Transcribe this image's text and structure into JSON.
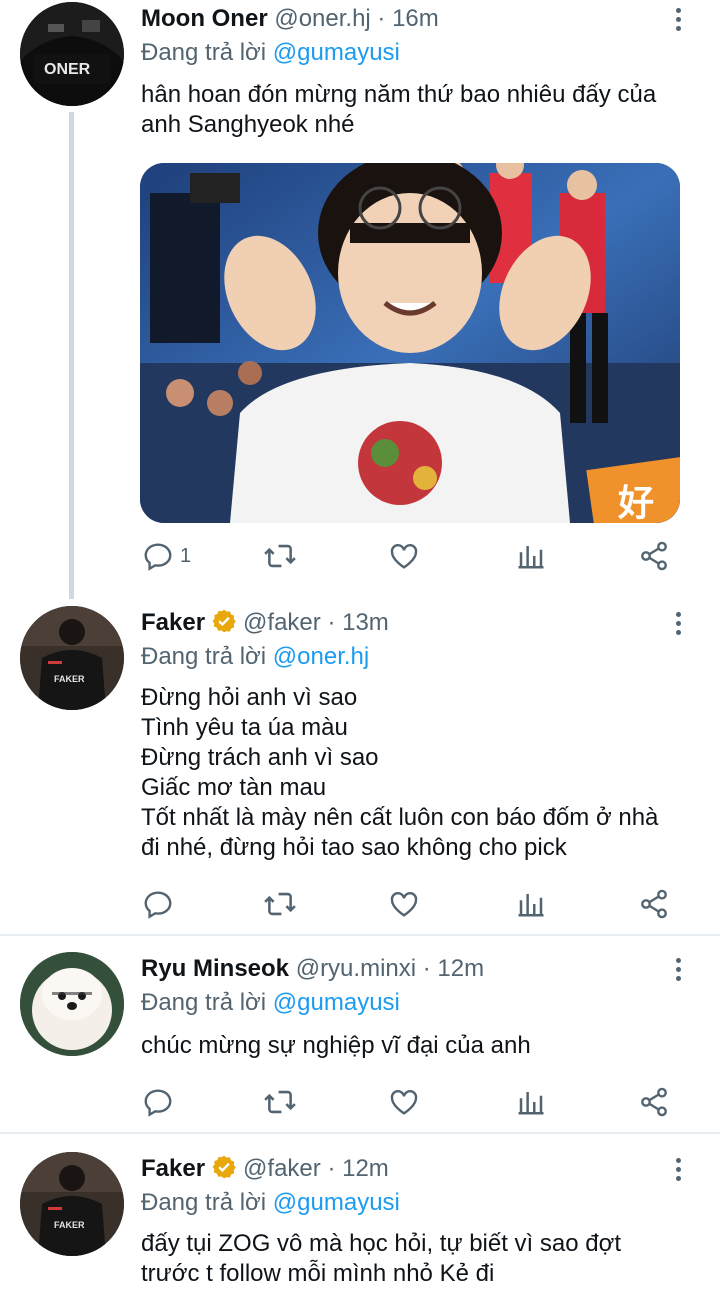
{
  "tweets": [
    {
      "name": "Moon Oner",
      "handle": "@oner.hj",
      "time": "· 16m",
      "reply_prefix": "Đang trả lời",
      "reply_to": "@gumayusi",
      "text": "hân hoan đón mừng năm thứ bao nhiêu đấy của\nanh Sanghyeok nhé",
      "avatar_label": "ONER",
      "reply_count": "1",
      "verified": false
    },
    {
      "name": "Faker",
      "handle": "@faker",
      "time": "· 13m",
      "reply_prefix": "Đang trả lời",
      "reply_to": "@oner.hj",
      "text": "Đừng hỏi anh vì sao\nTình yêu ta úa màu\nĐừng trách anh vì sao\nGiấc mơ tàn mau\nTốt nhất là mày nên cất luôn con báo đốm ở nhà\nđi nhé, đừng hỏi tao sao không cho pick",
      "avatar_label": "FAKER",
      "reply_count": "",
      "verified": true
    },
    {
      "name": "Ryu Minseok",
      "handle": "@ryu.minxi",
      "time": "· 12m",
      "reply_prefix": "Đang trả lời",
      "reply_to": "@gumayusi",
      "text": "chúc mừng sự nghiệp vĩ đại của anh",
      "avatar_label": "",
      "reply_count": "",
      "verified": false
    },
    {
      "name": "Faker",
      "handle": "@faker",
      "time": "· 12m",
      "reply_prefix": "Đang trả lời",
      "reply_to": "@gumayusi",
      "text": "đấy tụi ZOG vô mà học hỏi, tự biết vì sao đợt\ntrước t follow mỗi mình nhỏ Kẻ đi",
      "avatar_label": "FAKER",
      "reply_count": "",
      "verified": true
    }
  ],
  "media": {
    "description_icon": "photo",
    "overlay_text": "好"
  },
  "action_icons": [
    "reply-icon",
    "retweet-icon",
    "like-icon",
    "analytics-icon",
    "share-icon"
  ],
  "colors": {
    "accent": "#1d9bf0",
    "secondary_text": "#536471",
    "verified": "#f4b400",
    "thread_line": "#cfd9de"
  }
}
